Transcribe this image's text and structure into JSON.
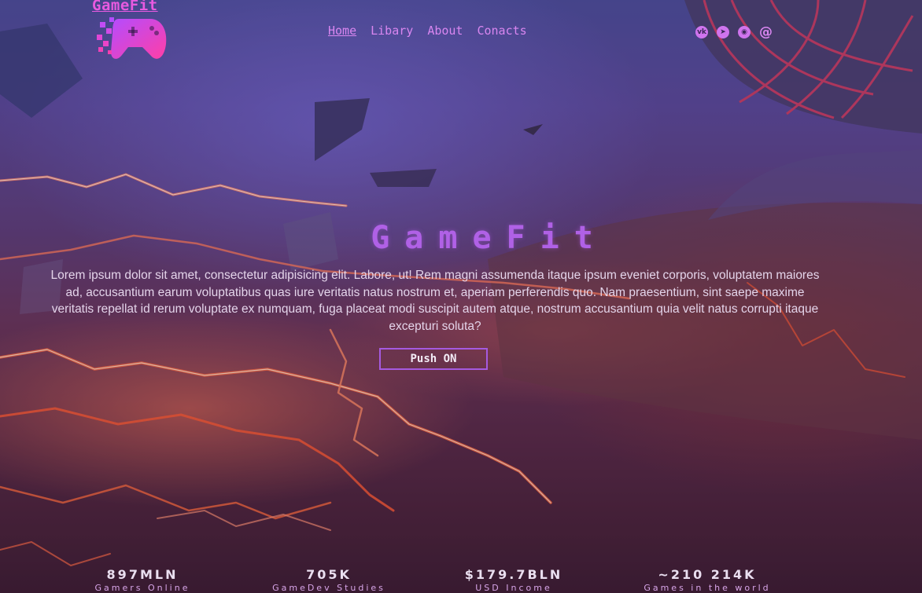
{
  "brand": {
    "name": "GameFit",
    "logo_icon": "gamepad-icon"
  },
  "nav": {
    "items": [
      {
        "label": "Home",
        "active": true
      },
      {
        "label": "Libary",
        "active": false
      },
      {
        "label": "About",
        "active": false
      },
      {
        "label": "Conacts",
        "active": false
      }
    ]
  },
  "socials": [
    {
      "name": "vk-icon",
      "glyph": "vk"
    },
    {
      "name": "telegram-icon",
      "glyph": "➤"
    },
    {
      "name": "steam-icon",
      "glyph": "◉"
    },
    {
      "name": "email-icon",
      "glyph": "@"
    }
  ],
  "hero": {
    "title": "GameFit",
    "text": "Lorem ipsum dolor sit amet, consectetur adipisicing elit. Labore, ut! Rem magni assumenda itaque ipsum eveniet corporis, voluptatem maiores ad, accusantium earum voluptatibus quas iure veritatis natus nostrum et, aperiam perferendis quo. Nam praesentium, sint saepe maxime veritatis repellat id rerum voluptate ex numquam, fuga placeat modi suscipit autem atque, nostrum accusantium quia velit natus corrupti itaque excepturi soluta?",
    "cta": "Push ON"
  },
  "stats": [
    {
      "value": "897MLN",
      "label": "Gamers Online"
    },
    {
      "value": "705K",
      "label": "GameDev Studies"
    },
    {
      "value": "$179.7BLN",
      "label": "USD Income"
    },
    {
      "value": "~210 214K",
      "label": "Games in the world"
    }
  ],
  "colors": {
    "accent": "#b061e6",
    "nav": "#d986f0",
    "logo": "#e85ae0"
  }
}
